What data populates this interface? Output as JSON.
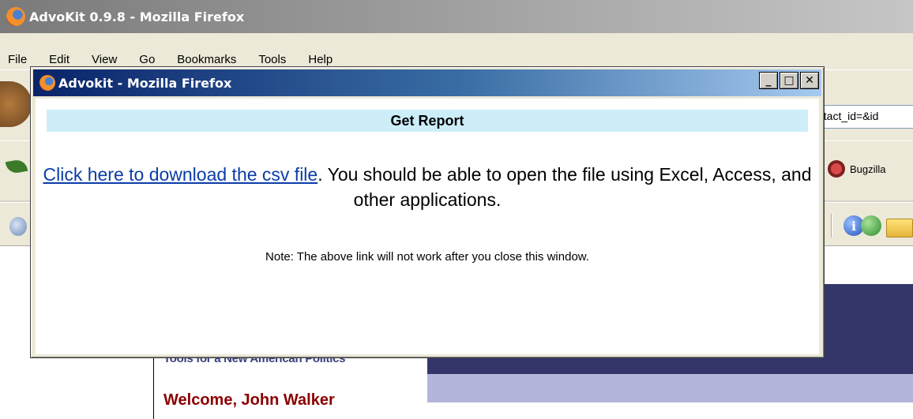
{
  "main_window": {
    "title": "AdvoKit 0.9.8 - Mozilla Firefox",
    "menu": [
      "File",
      "Edit",
      "View",
      "Go",
      "Bookmarks",
      "Tools",
      "Help"
    ],
    "url_fragment": "ntact_id=&id",
    "bookmark": "Bugzilla"
  },
  "page": {
    "tagline": "Tools for a New American Politics",
    "welcome": "Welcome, John Walker"
  },
  "popup": {
    "title": "Advokit - Mozilla Firefox",
    "controls": {
      "minimize": "_",
      "maximize": "□",
      "close": "✕"
    },
    "header": "Get Report",
    "link_text": "Click here to download the csv file",
    "message_after_link": ". You should be able to open the file using Excel, Access, and other applications.",
    "note": "Note: The above link will not work after you close this window."
  }
}
